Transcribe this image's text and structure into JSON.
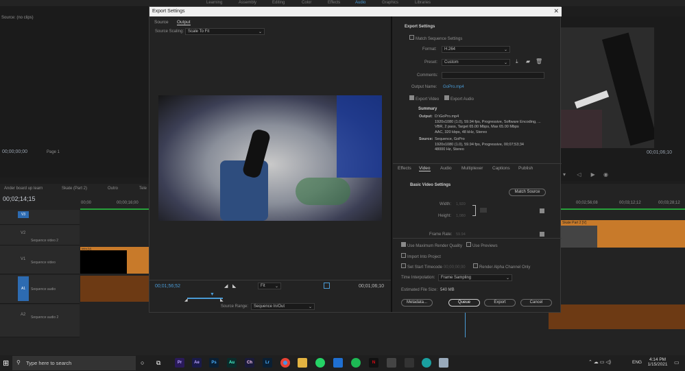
{
  "premiere": {
    "tabs": [
      "Learning",
      "Assembly",
      "Editing",
      "Color",
      "Effects",
      "Audio",
      "Graphics",
      "Libraries"
    ],
    "source_label": "Source: (no clips)",
    "source_tc": "00;00;00;00",
    "page": "Page 1",
    "prog_tc": "00;01;06;10",
    "timeline_tabs": [
      "Ander board up learn",
      "Skate (Part 2)",
      "Outro",
      "Tele"
    ],
    "tl_tc": "00;02;14;15",
    "ruler": [
      "00;00",
      "00;00;16;00",
      "00;02;56;08",
      "00;03;12;12",
      "00;03;28;12"
    ],
    "tracks": [
      {
        "id": "V3",
        "name": ""
      },
      {
        "id": "V2",
        "name": "Sequence video 2"
      },
      {
        "id": "V1",
        "name": "Sequence video"
      },
      {
        "id": "A1",
        "name": "Sequence audio"
      },
      {
        "id": "A2",
        "name": "Sequence audio 2"
      }
    ],
    "clip1": "Intro [V]",
    "clip2": "Skate Part 2 [V]"
  },
  "dialog": {
    "title": "Export Settings",
    "close": "✕",
    "tabs": [
      "Source",
      "Output"
    ],
    "scaling_label": "Source Scaling:",
    "scaling_value": "Scale To Fit",
    "tc_in": "00;01;56;52",
    "fit": "Fit",
    "tc_out": "00;01;06;10",
    "range_label": "Source Range:",
    "range_value": "Sequence In/Out",
    "export_settings": "Export Settings",
    "match_seq": "Match Sequence Settings",
    "format_label": "Format:",
    "format_value": "H.264",
    "preset_label": "Preset:",
    "preset_value": "Custom",
    "comments_label": "Comments:",
    "outname_label": "Output Name:",
    "outname_value": "GoPro.mp4",
    "export_video": "Export Video",
    "export_audio": "Export Audio",
    "summary": "Summary",
    "output_label": "Output:",
    "output_lines": [
      "D:\\GoPro.mp4",
      "1920x1080 (1.0), 59.94 fps, Progressive, Software Encoding, ...",
      "VBR, 2 pass, Target 65.00 Mbps, Max 65.00 Mbps",
      "AAC, 320 kbps, 48 kHz, Stereo"
    ],
    "source_label": "Source:",
    "source_lines": [
      "Sequence, GoPro",
      "1920x1080 (1.0), 59.94 fps, Progressive, 00;07;53;34",
      "48000 Hz, Stereo"
    ],
    "sub_tabs": [
      "Effects",
      "Video",
      "Audio",
      "Multiplexer",
      "Captions",
      "Publish"
    ],
    "basic_video": "Basic Video Settings",
    "match_source": "Match Source",
    "width_label": "Width:",
    "width_value": "1,920",
    "height_label": "Height:",
    "height_value": "1,080",
    "framerate_label": "Frame Rate:",
    "framerate_value": "59.94",
    "max_render": "Use Maximum Render Quality",
    "use_previews": "Use Previews",
    "import_project": "Import Into Project",
    "start_tc": "Set Start Timecode",
    "start_tc_value": "00;00;00;00",
    "render_alpha": "Render Alpha Channel Only",
    "time_interp_label": "Time Interpolation:",
    "time_interp_value": "Frame Sampling",
    "filesize_label": "Estimated File Size:",
    "filesize_value": "540 MB",
    "metadata": "Metadata...",
    "queue": "Queue",
    "export": "Export",
    "cancel": "Cancel"
  },
  "taskbar": {
    "search": "Type here to search",
    "apps": [
      "Pr",
      "Ae",
      "Ps",
      "Au",
      "Ch",
      "Lr"
    ],
    "lang": "ENG",
    "time": "4:14 PM",
    "date": "1/15/2021"
  },
  "colors": {
    "accent": "#4a9bd6",
    "clip": "#c87a2a",
    "panel": "#232323"
  }
}
